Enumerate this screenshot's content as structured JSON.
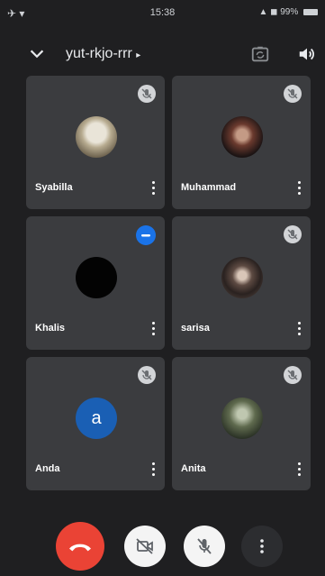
{
  "status_bar": {
    "time": "15:38",
    "battery": "99%"
  },
  "header": {
    "meeting_code": "yut-rkjo-rrr"
  },
  "participants": [
    {
      "name": "Syabilla",
      "mic_state": "muted"
    },
    {
      "name": "Muhammad",
      "mic_state": "muted"
    },
    {
      "name": "Khalis",
      "mic_state": "speaking"
    },
    {
      "name": "sarisa",
      "mic_state": "muted"
    },
    {
      "name": "Anda",
      "mic_state": "muted",
      "avatar_letter": "a",
      "avatar_color": "#1a5fb4"
    },
    {
      "name": "Anita",
      "mic_state": "muted"
    }
  ],
  "colors": {
    "background": "#1f1f21",
    "tile": "#3b3c3f",
    "end_call": "#ea4335",
    "speaking": "#1a73e8"
  },
  "controls": [
    "end-call",
    "camera-off",
    "mic-off",
    "more-options"
  ]
}
